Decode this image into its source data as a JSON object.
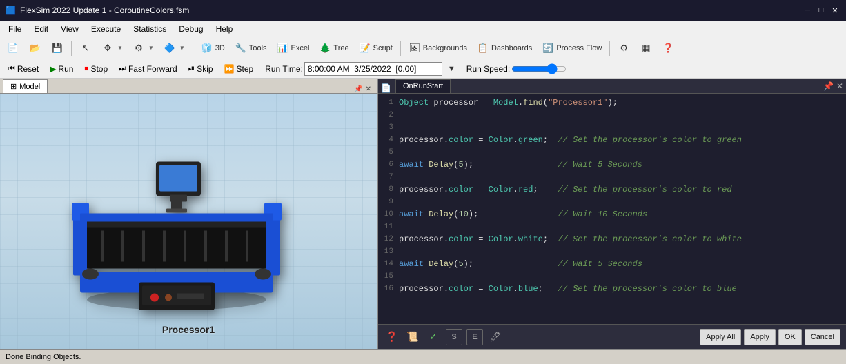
{
  "titleBar": {
    "title": "FlexSim 2022 Update 1 - CoroutineColors.fsm",
    "icon": "🟦"
  },
  "menuBar": {
    "items": [
      "File",
      "Edit",
      "View",
      "Execute",
      "Statistics",
      "Debug",
      "Help"
    ]
  },
  "toolbar": {
    "buttons": [
      {
        "label": "3D",
        "icon": "🧊"
      },
      {
        "label": "Tools",
        "icon": "🔧"
      },
      {
        "label": "Excel",
        "icon": "📊"
      },
      {
        "label": "Tree",
        "icon": "🌲"
      },
      {
        "label": "Script",
        "icon": "📝"
      },
      {
        "label": "Backgrounds",
        "icon": "🖼"
      },
      {
        "label": "Dashboards",
        "icon": "📋"
      },
      {
        "label": "Process Flow",
        "icon": "🔄"
      }
    ]
  },
  "runToolbar": {
    "resetLabel": "Reset",
    "runLabel": "Run",
    "stopLabel": "Stop",
    "fastForwardLabel": "Fast Forward",
    "skipLabel": "Skip",
    "stepLabel": "Step",
    "runTimeLabel": "Run Time:",
    "runTimeValue": "8:00:00 AM  3/25/2022  [0.00]",
    "runSpeedLabel": "Run Speed:"
  },
  "modelPanel": {
    "tabLabel": "Model",
    "processorLabel": "Processor1"
  },
  "codePanel": {
    "tabLabel": "OnRunStart",
    "lines": [
      {
        "num": 1,
        "code": "Object processor = Model.find(\"Processor1\");"
      },
      {
        "num": 2,
        "code": ""
      },
      {
        "num": 3,
        "code": ""
      },
      {
        "num": 4,
        "code": "processor.color = Color.green;  // Set the processor's color to green"
      },
      {
        "num": 5,
        "code": ""
      },
      {
        "num": 6,
        "code": "await Delay(5);                 // Wait 5 Seconds"
      },
      {
        "num": 7,
        "code": ""
      },
      {
        "num": 8,
        "code": "processor.color = Color.red;    // Set the processor's color to red"
      },
      {
        "num": 9,
        "code": ""
      },
      {
        "num": 10,
        "code": "await Delay(10);                // Wait 10 Seconds"
      },
      {
        "num": 11,
        "code": ""
      },
      {
        "num": 12,
        "code": "processor.color = Color.white;  // Set the processor's color to white"
      },
      {
        "num": 13,
        "code": ""
      },
      {
        "num": 14,
        "code": "await Delay(5);                 // Wait 5 Seconds"
      },
      {
        "num": 15,
        "code": ""
      },
      {
        "num": 16,
        "code": "processor.color = Color.blue;   // Set the processor's color to blue"
      }
    ],
    "bottomButtons": {
      "applyAll": "Apply All",
      "apply": "Apply",
      "ok": "OK",
      "cancel": "Cancel"
    }
  },
  "statusBar": {
    "text": "Done Binding Objects."
  }
}
